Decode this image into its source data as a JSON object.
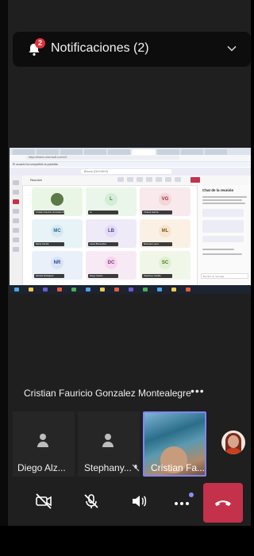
{
  "notification": {
    "title": "Notificaciones (2)",
    "badge": "2"
  },
  "shared_screen": {
    "address": "https://teams.microsoft.com/v2/",
    "banner": "El usuario ha compartido su pantalla.",
    "search_placeholder": "Buscar (Ctrl+Alt+E)",
    "meeting_label": "Reunión",
    "chat_title": "Chat de la reunión",
    "chat_input_placeholder": "Escribir un mensaje",
    "tiles": [
      {
        "initials": "",
        "avatar_bg": "#e0f0d8",
        "avatar_fg": "#2e6b2a",
        "tile_bg": "#eaf6e5",
        "label": "Cristian Fauricio Gonzalez Montealegre"
      },
      {
        "initials": "L",
        "avatar_bg": "#d4edd6",
        "avatar_fg": "#2f7b40",
        "tile_bg": "#eaf6ea",
        "label": "Lo"
      },
      {
        "initials": "VG",
        "avatar_bg": "#f4d6da",
        "avatar_fg": "#9b2c3c",
        "tile_bg": "#f8e9ec",
        "label": "Viviana Garzon"
      },
      {
        "initials": "MC",
        "avatar_bg": "#d6eaf4",
        "avatar_fg": "#2b6e8f",
        "tile_bg": "#e8f3f8",
        "label": "Maria Camila"
      },
      {
        "initials": "LB",
        "avatar_bg": "#e4dcf4",
        "avatar_fg": "#5a3e9a",
        "tile_bg": "#efeaf8",
        "label": "Laura Benavides"
      },
      {
        "initials": "ML",
        "avatar_bg": "#f6e6cf",
        "avatar_fg": "#8a5a1c",
        "tile_bg": "#faf1e4",
        "label": "Manuela Lopez"
      },
      {
        "initials": "NR",
        "avatar_bg": "#d8e4f6",
        "avatar_fg": "#2b4e8f",
        "tile_bg": "#e9f0fa",
        "label": "Nicolas Rodriguez"
      },
      {
        "initials": "DC",
        "avatar_bg": "#f4d8ee",
        "avatar_fg": "#8c2e7b",
        "tile_bg": "#f8eaf4",
        "label": "Diego Castro"
      },
      {
        "initials": "SC",
        "avatar_bg": "#e2f0d2",
        "avatar_fg": "#4e7a22",
        "tile_bg": "#f0f7e8",
        "label": "Stephany Castillo"
      }
    ]
  },
  "presenter": {
    "name": "Cristian Fauricio Gonzalez Montealegre",
    "more": "•••"
  },
  "participants": [
    {
      "name": "Diego Alz...",
      "muted": true
    },
    {
      "name": "Stephany...",
      "muted": true
    }
  ],
  "self_video": {
    "name": "Cristian Fa..."
  },
  "controls": {
    "camera": "camera-off-icon",
    "mic": "mic-off-icon",
    "speaker": "speaker-icon",
    "more": "more-icon",
    "end_call": "end-call-icon",
    "end_call_color": "#c4314b",
    "accent": "#7f85f5"
  }
}
